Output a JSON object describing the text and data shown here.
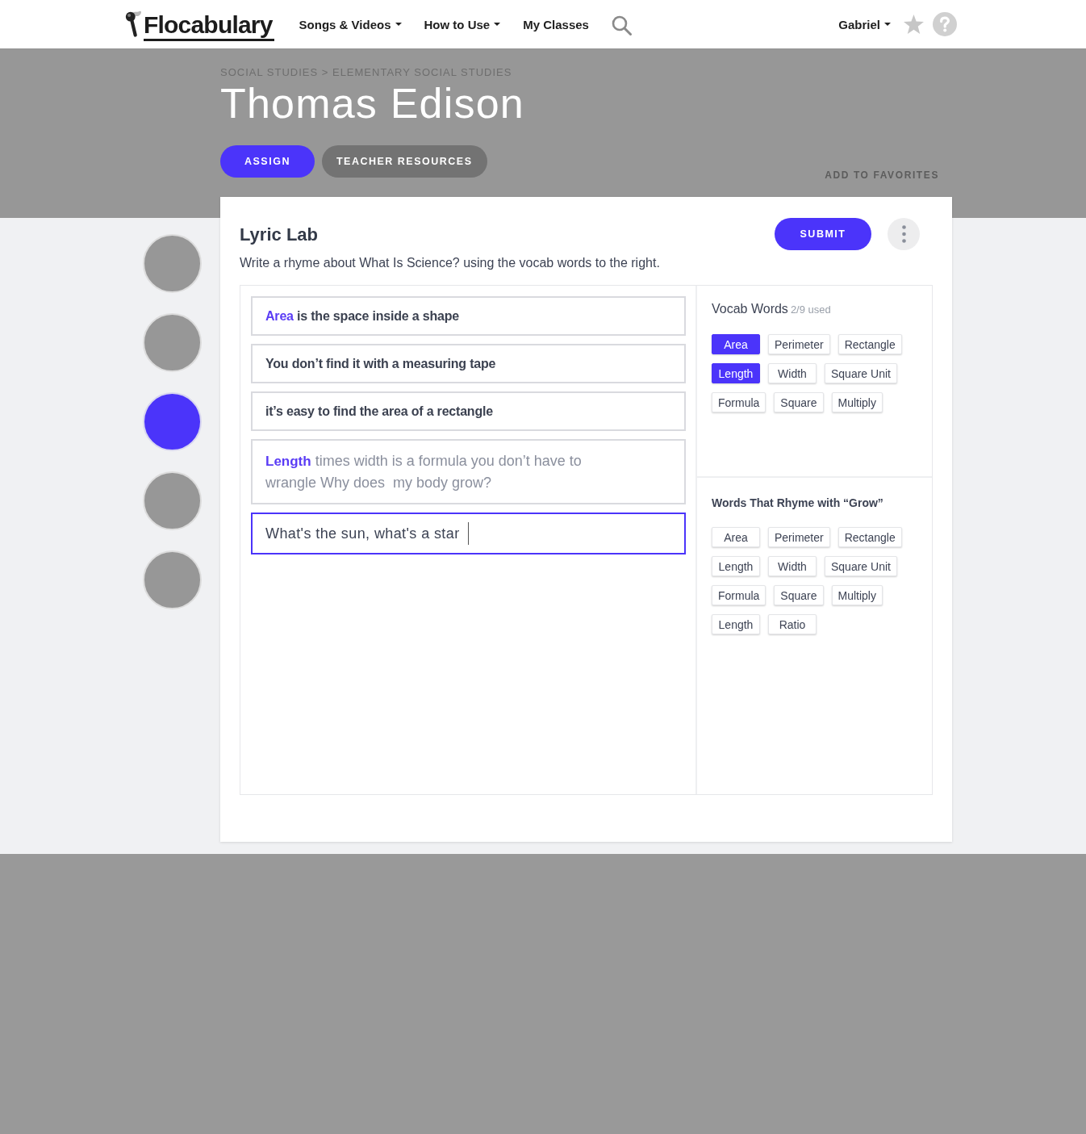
{
  "nav": {
    "logo_text": "Flocabulary",
    "items": [
      {
        "label": "Songs & Videos",
        "dropdown": true
      },
      {
        "label": "How to Use",
        "dropdown": true
      },
      {
        "label": "My Classes",
        "dropdown": false
      }
    ],
    "user": {
      "name": "Gabriel",
      "dropdown": true
    }
  },
  "header": {
    "breadcrumb": "SOCIAL STUDIES > ELEMENTARY SOCIAL STUDIES",
    "title": "Thomas Edison",
    "buttons": [
      {
        "label": "ASSIGN",
        "kind": "primary"
      },
      {
        "label": "TEACHER RESOURCES",
        "kind": "secondary"
      }
    ],
    "favorite_link": "ADD TO FAVORITES"
  },
  "steps": [
    {
      "selected": false
    },
    {
      "selected": false
    },
    {
      "selected": true
    },
    {
      "selected": false
    },
    {
      "selected": false
    }
  ],
  "lyric_lab": {
    "title": "Lyric Lab",
    "prompt": "Write a rhyme about What Is Science? using the vocab words to the right.",
    "submit": "SUBMIT",
    "lines": [
      {
        "kind": "saved",
        "vocab_word": "Area",
        "text": "is the space inside a shape",
        "focused": false
      },
      {
        "kind": "saved",
        "text": "You don’t find it with a measuring tape",
        "focused": false
      },
      {
        "kind": "saved",
        "text": "it’s easy to find the area of a rectangle",
        "focused": false
      },
      {
        "kind": "draft",
        "vocab_word": "Length",
        "text": "times width is a formula you don’t have to wrangle Why does  my body grow?",
        "focused": false
      },
      {
        "kind": "input",
        "value": "What's the sun, what's a star",
        "focused": true
      }
    ],
    "vocab": {
      "title": "Vocab Words",
      "count": "2/9 used",
      "words": [
        {
          "label": "Area",
          "used": true
        },
        {
          "label": "Perimeter",
          "used": false
        },
        {
          "label": "Rectangle",
          "used": false
        },
        {
          "label": "Length",
          "used": true
        },
        {
          "label": "Width",
          "used": false
        },
        {
          "label": "Square Unit",
          "used": false
        },
        {
          "label": "Formula",
          "used": false
        },
        {
          "label": "Square",
          "used": false
        },
        {
          "label": "Multiply",
          "used": false
        }
      ]
    },
    "rhymes": {
      "title": "Words That Rhyme with “Grow”",
      "words": [
        "Area",
        "Perimeter",
        "Rectangle",
        "Length",
        "Width",
        "Square Unit",
        "Formula",
        "Square",
        "Multiply",
        "Length",
        "Ratio"
      ]
    }
  }
}
